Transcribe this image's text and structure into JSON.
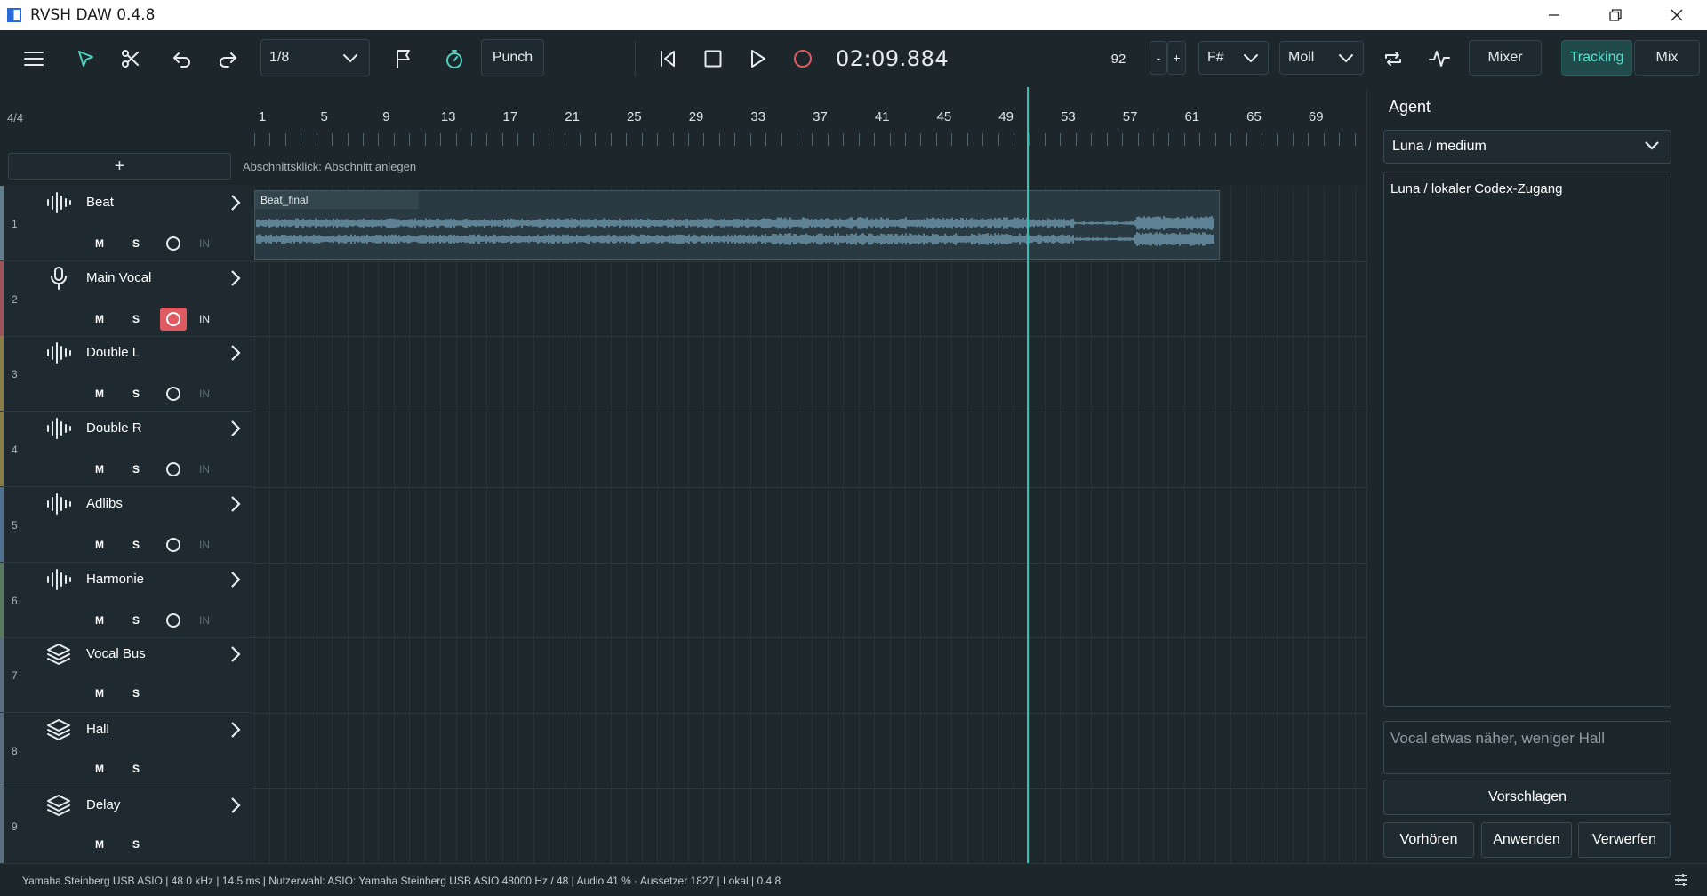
{
  "window": {
    "title": "RVSH DAW 0.4.8"
  },
  "toolbar": {
    "grid_value": "1/8",
    "punch_label": "Punch",
    "time": "02:09.884",
    "tempo": "92",
    "tempo_minus": "-",
    "tempo_plus": "+",
    "key": "F#",
    "scale": "Moll",
    "mixer_label": "Mixer",
    "tracking_label": "Tracking",
    "mix_label": "Mix",
    "active_mode": "Tracking",
    "accent_color": "#4fd1c1"
  },
  "ruler": {
    "time_signature": "4/4",
    "bars": [
      "1",
      "5",
      "9",
      "13",
      "17",
      "21",
      "25",
      "29",
      "33",
      "37",
      "41",
      "45",
      "49",
      "53",
      "57",
      "61",
      "65",
      "69"
    ]
  },
  "section": {
    "add_label": "+",
    "hint": "Abschnittsklick: Abschnitt anlegen"
  },
  "tracks": [
    {
      "num": "1",
      "name": "Beat",
      "icon": "waveform-icon",
      "color": "#5f7d8a",
      "rec": true,
      "armed": false,
      "in": "IN",
      "in_active": false
    },
    {
      "num": "2",
      "name": "Main Vocal",
      "icon": "microphone-icon",
      "color": "#a0525b",
      "rec": true,
      "armed": true,
      "in": "IN",
      "in_active": true
    },
    {
      "num": "3",
      "name": "Double L",
      "icon": "waveform-icon",
      "color": "#8a7d45",
      "rec": true,
      "armed": false,
      "in": "IN",
      "in_active": false
    },
    {
      "num": "4",
      "name": "Double R",
      "icon": "waveform-icon",
      "color": "#8a7d45",
      "rec": true,
      "armed": false,
      "in": "IN",
      "in_active": false
    },
    {
      "num": "5",
      "name": "Adlibs",
      "icon": "waveform-icon",
      "color": "#4f6f8f",
      "rec": true,
      "armed": false,
      "in": "IN",
      "in_active": false
    },
    {
      "num": "6",
      "name": "Harmonie",
      "icon": "waveform-icon",
      "color": "#5a7a5f",
      "rec": true,
      "armed": false,
      "in": "IN",
      "in_active": false
    },
    {
      "num": "7",
      "name": "Vocal Bus",
      "icon": "layers-icon",
      "color": "#5a7080",
      "rec": false
    },
    {
      "num": "8",
      "name": "Hall",
      "icon": "layers-icon",
      "color": "#5a7080",
      "rec": false
    },
    {
      "num": "9",
      "name": "Delay",
      "icon": "layers-icon",
      "color": "#5a7080",
      "rec": false
    }
  ],
  "track_buttons": {
    "mute": "M",
    "solo": "S"
  },
  "clip": {
    "name": "Beat_final"
  },
  "agent": {
    "title": "Agent",
    "model": "Luna / medium",
    "log_text": "Luna / lokaler Codex-Zugang",
    "prompt_placeholder": "Vocal etwas näher, weniger Hall",
    "suggest_label": "Vorschlagen",
    "preview_label": "Vorhören",
    "apply_label": "Anwenden",
    "discard_label": "Verwerfen"
  },
  "status": {
    "text": "Yamaha Steinberg USB ASIO | 48.0 kHz | 14.5 ms   |   Nutzerwahl: ASIO: Yamaha Steinberg USB ASIO 48000 Hz / 48   |   Audio 41 % · Aussetzer 1827   |   Lokal   |   0.4.8"
  }
}
